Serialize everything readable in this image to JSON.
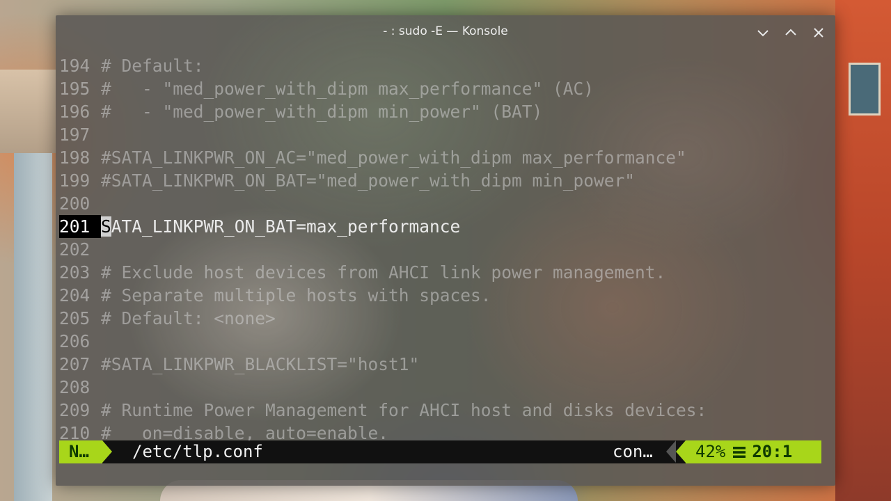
{
  "window": {
    "title": "- : sudo -E — Konsole"
  },
  "icons": {
    "minimize": "chevron-down-icon",
    "maximize": "chevron-up-icon",
    "close": "close-icon",
    "lines": "hamburger-lines-icon"
  },
  "editor": {
    "lines": [
      {
        "num": "194",
        "text": "# Default:"
      },
      {
        "num": "195",
        "text": "#   - \"med_power_with_dipm max_performance\" (AC)"
      },
      {
        "num": "196",
        "text": "#   - \"med_power_with_dipm min_power\" (BAT)"
      },
      {
        "num": "197",
        "text": ""
      },
      {
        "num": "198",
        "text": "#SATA_LINKPWR_ON_AC=\"med_power_with_dipm max_performance\""
      },
      {
        "num": "199",
        "text": "#SATA_LINKPWR_ON_BAT=\"med_power_with_dipm min_power\""
      },
      {
        "num": "200",
        "text": ""
      },
      {
        "num": "201",
        "text": "SATA_LINKPWR_ON_BAT=max_performance",
        "current": true
      },
      {
        "num": "202",
        "text": ""
      },
      {
        "num": "203",
        "text": "# Exclude host devices from AHCI link power management."
      },
      {
        "num": "204",
        "text": "# Separate multiple hosts with spaces."
      },
      {
        "num": "205",
        "text": "# Default: <none>"
      },
      {
        "num": "206",
        "text": ""
      },
      {
        "num": "207",
        "text": "#SATA_LINKPWR_BLACKLIST=\"host1\""
      },
      {
        "num": "208",
        "text": ""
      },
      {
        "num": "209",
        "text": "# Runtime Power Management for AHCI host and disks devices:"
      },
      {
        "num": "210",
        "text": "#   on=disable, auto=enable."
      }
    ],
    "cursor_line": "201"
  },
  "statusline": {
    "mode": "N…",
    "filename": "/etc/tlp.conf",
    "filetype": "con…",
    "percent": "42%",
    "position": "20:1"
  },
  "colors": {
    "mode_bg": "#a8d61a",
    "mode_fg": "#0e3a00",
    "statusline_bg": "#111111"
  }
}
